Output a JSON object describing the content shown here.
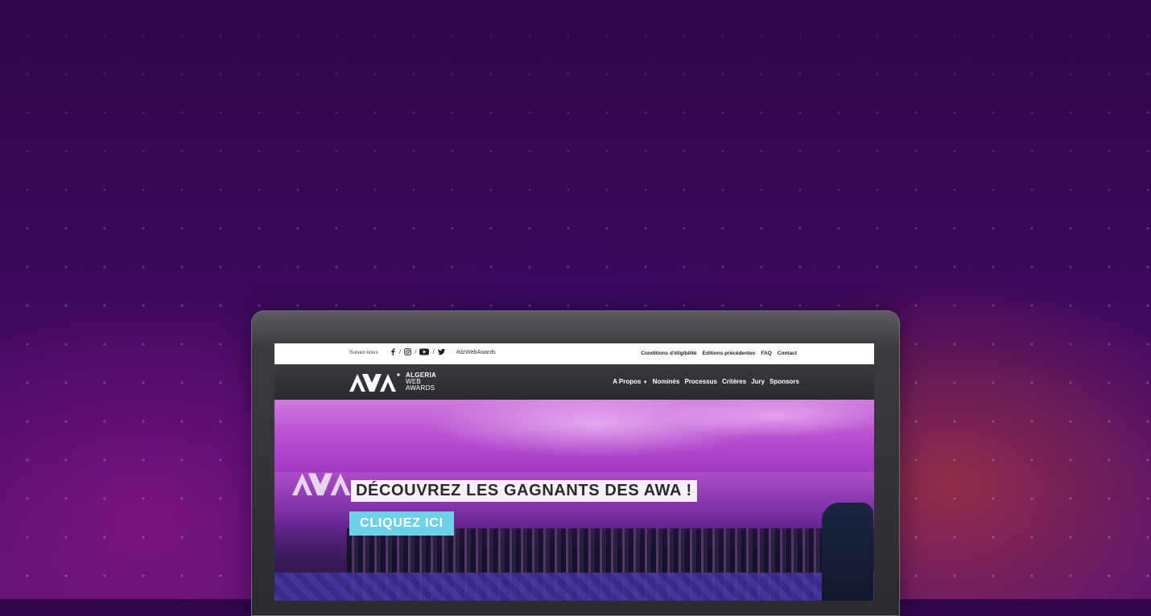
{
  "topbar": {
    "follow_label": "Suivez-nous",
    "separator": "/",
    "hashtag": "#dzWebAwards",
    "social_icons": [
      "facebook-icon",
      "instagram-icon",
      "youtube-icon",
      "twitter-icon"
    ],
    "links": [
      "Conditions d'éligibilité",
      "Editions précédentes",
      "FAQ",
      "Contact"
    ]
  },
  "nav": {
    "logo": {
      "line1": "ALGERIA",
      "line2": "WEB",
      "line3": "AWARDS"
    },
    "items": [
      "A Propos",
      "Nominés",
      "Processus",
      "Critères",
      "Jury",
      "Sponsors"
    ],
    "dropdown_icon": "caret-down-icon"
  },
  "hero": {
    "headline": "DÉCOUVREZ LES GAGNANTS DES AWA !",
    "cta_label": "CLIQUEZ ICI"
  },
  "colors": {
    "background": "#3a0858",
    "cta": "#6fd1e6",
    "navbar": "#2f2f33",
    "hero_tint": "#b850d0"
  }
}
